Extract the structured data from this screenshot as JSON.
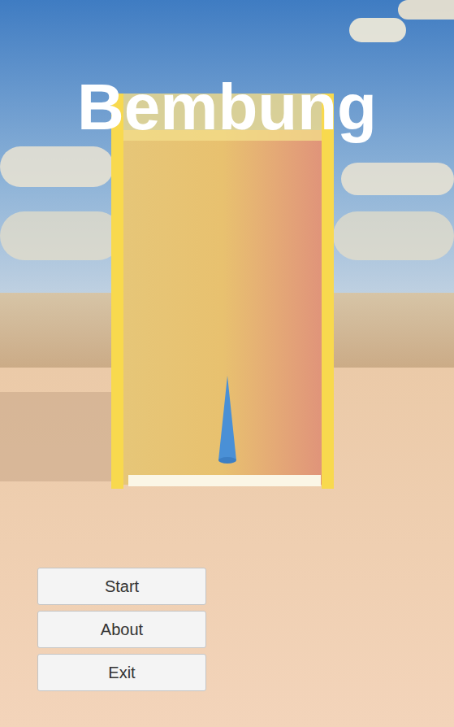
{
  "title": "Bembung",
  "menu": [
    {
      "label": "Start"
    },
    {
      "label": "About"
    },
    {
      "label": "Exit"
    }
  ]
}
